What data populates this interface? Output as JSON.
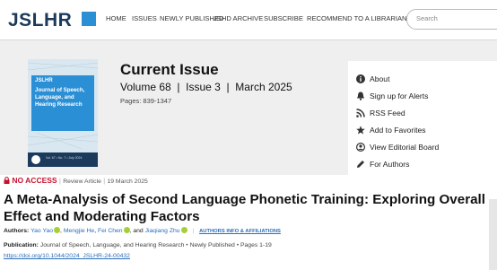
{
  "header": {
    "logo": "JSLHR",
    "nav": [
      "HOME",
      "ISSUES",
      "NEWLY PUBLISHED",
      "JSHD ARCHIVE",
      "SUBSCRIBE",
      "RECOMMEND TO A LIBRARIAN"
    ],
    "search_placeholder": "Search"
  },
  "issue": {
    "cover": {
      "label": "JSLHR",
      "title": "Journal of Speech, Language, and Hearing Research",
      "footer": "Vol. 67 • No. 7 • July 2024"
    },
    "heading": "Current Issue",
    "volume_line": "Volume 68  |  Issue 3  |  March 2025",
    "pages": "Pages: 839-1347"
  },
  "panel": {
    "items": [
      {
        "label": "About",
        "icon": "info-icon"
      },
      {
        "label": "Sign up for Alerts",
        "icon": "bell-icon"
      },
      {
        "label": "RSS Feed",
        "icon": "rss-icon"
      },
      {
        "label": "Add to Favorites",
        "icon": "star-icon"
      },
      {
        "label": "View Editorial Board",
        "icon": "person-icon"
      },
      {
        "label": "For Authors",
        "icon": "pen-icon"
      }
    ]
  },
  "article": {
    "access": "NO ACCESS",
    "type": "Review Article",
    "date": "19 March 2025",
    "title": "A Meta-Analysis of Second Language Phonetic Training: Exploring Overall Effect and Moderating Factors",
    "authors_label": "Authors:",
    "author1": "Yao Yao",
    "author2": "Mengjie He",
    "author3": "Fei Chen",
    "and": ", and",
    "author4": "Jiaqiang Zhu",
    "authors_info": "AUTHORS INFO & AFFILIATIONS",
    "publication_label": "Publication:",
    "publication": "Journal of Speech, Language, and Hearing Research",
    "newly": "Newly Published",
    "pages": "Pages 1-19",
    "doi": "https://doi.org/10.1044/2024_JSLHR-24-00432"
  },
  "colors": {
    "brand": "#1b3a5c",
    "accent": "#2b8fd6",
    "link": "#2a6ebb",
    "noaccess": "#c8102e",
    "orcid": "#a6ce39"
  }
}
